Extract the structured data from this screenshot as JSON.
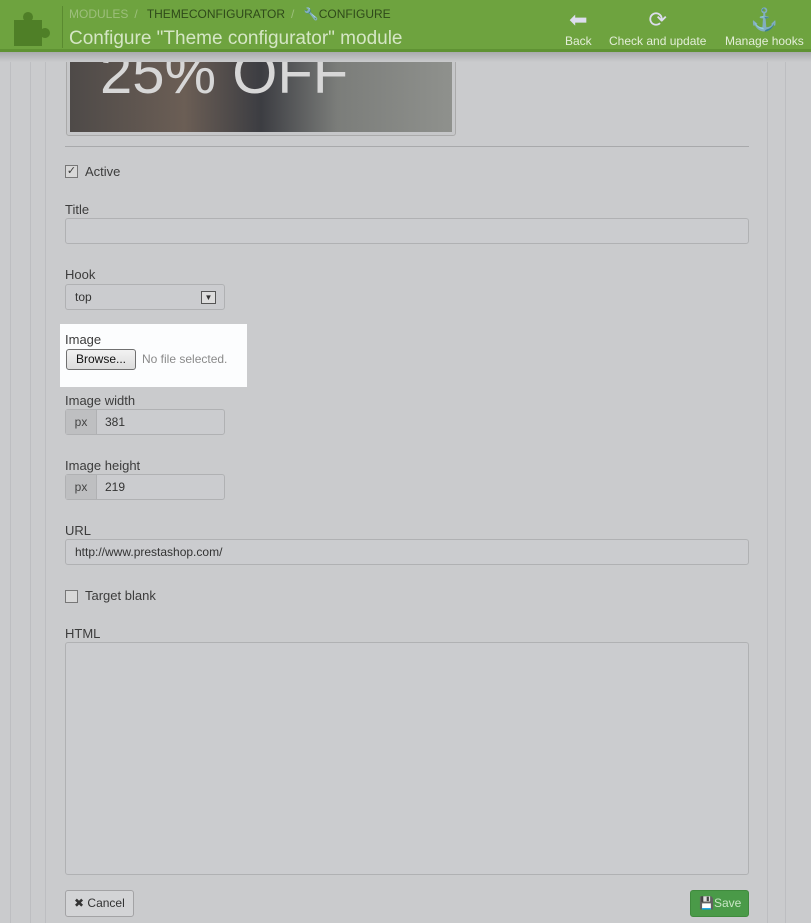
{
  "header": {
    "breadcrumb": [
      "MODULES",
      "THEMECONFIGURATOR",
      "CONFIGURE"
    ],
    "title": "Configure \"Theme configurator\" module",
    "toolbar": [
      {
        "label": "Back",
        "icon": "arrow-left-circle-icon"
      },
      {
        "label": "Check and update",
        "icon": "refresh-icon"
      },
      {
        "label": "Manage hooks",
        "icon": "anchor-icon"
      }
    ],
    "accent": "#6ea33f"
  },
  "banner": {
    "text": "25% OFF"
  },
  "form": {
    "active": {
      "label": "Active",
      "checked": true
    },
    "title": {
      "label": "Title",
      "value": ""
    },
    "hook": {
      "label": "Hook",
      "value": "top"
    },
    "image": {
      "label": "Image",
      "browse": "Browse...",
      "status": "No file selected."
    },
    "image_width": {
      "label": "Image width",
      "unit": "px",
      "value": "381"
    },
    "image_height": {
      "label": "Image height",
      "unit": "px",
      "value": "219"
    },
    "url": {
      "label": "URL",
      "value": "http://www.prestashop.com/"
    },
    "target_blank": {
      "label": "Target blank",
      "checked": false
    },
    "html": {
      "label": "HTML",
      "value": ""
    },
    "cancel": "Cancel",
    "save": "Save"
  }
}
